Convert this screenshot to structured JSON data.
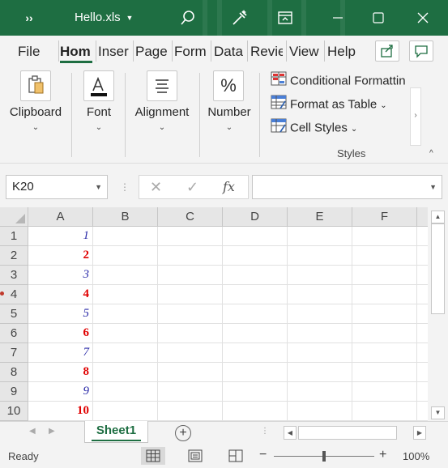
{
  "titlebar": {
    "qat_label": "››",
    "file_name": "Hello.xls",
    "bg_color": "#1e6e42"
  },
  "ribbon": {
    "tabs": [
      "File",
      "Hom",
      "Inser",
      "Page",
      "Form",
      "Data",
      "Revie",
      "View",
      "Help"
    ],
    "active_tab": "Hom",
    "groups": {
      "clipboard": "Clipboard",
      "font": "Font",
      "alignment": "Alignment",
      "number": "Number"
    },
    "styles": {
      "conditional_formatting": "Conditional Formattin",
      "format_as_table": "Format as Table",
      "cell_styles": "Cell Styles",
      "group_label": "Styles"
    }
  },
  "formula_bar": {
    "name_box": "K20",
    "fx_label": "fx",
    "formula": ""
  },
  "grid": {
    "columns": [
      "A",
      "B",
      "C",
      "D",
      "E",
      "F"
    ],
    "rows": [
      "1",
      "2",
      "3",
      "4",
      "5",
      "6",
      "7",
      "8",
      "9",
      "10"
    ],
    "column_a_values": [
      "1",
      "2",
      "3",
      "4",
      "5",
      "6",
      "7",
      "8",
      "9",
      "10"
    ],
    "odd_color": "#2a2aa8",
    "even_color": "#e00000"
  },
  "sheets": {
    "tabs": [
      "Sheet1"
    ],
    "active": "Sheet1"
  },
  "statusbar": {
    "status": "Ready",
    "zoom": "100%"
  }
}
